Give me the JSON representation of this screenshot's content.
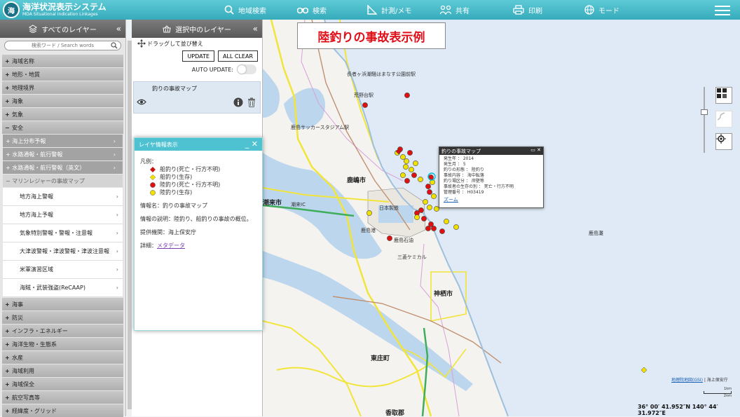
{
  "app": {
    "title": "海洋状況表示システム",
    "subtitle": "MDA Situational Indication Linkages",
    "badge": "海"
  },
  "nav": [
    {
      "label": "地域検索",
      "icon": "search-icon"
    },
    {
      "label": "検索",
      "icon": "binoculars-icon"
    },
    {
      "label": "計測/メモ",
      "icon": "ruler-icon"
    },
    {
      "label": "共有",
      "icon": "share-icon"
    },
    {
      "label": "印刷",
      "icon": "printer-icon"
    },
    {
      "label": "モード",
      "icon": "globe-icon"
    }
  ],
  "panel_all": {
    "title": "すべてのレイヤー",
    "search_placeholder": "検索ワード / Search words",
    "categories_top": [
      "海域名称",
      "地形・地質",
      "地理境界",
      "海象",
      "気象"
    ],
    "open_category": "安全",
    "subcategories": [
      "海上分布予報",
      "水路通報・航行警報",
      "水路通報・航行警報（英文）"
    ],
    "active_sub": "マリンレジャーの事故マップ",
    "leaves": [
      "地方海上警報",
      "地方海上予報",
      "気象特別警報・警報・注意報",
      "大津波警報・津波警報・津波注意報",
      "米軍演習区域",
      "海賊・武装強盗(ReCAAP)"
    ],
    "categories_bottom": [
      "海事",
      "防災",
      "インフラ・エネルギー",
      "海洋生物・生態系",
      "水産",
      "海域利用",
      "海域保全",
      "航空写真等",
      "経緯度・グリッド"
    ]
  },
  "panel_sel": {
    "title": "選択中のレイヤー",
    "drag_hint": "ドラッグして並び替え",
    "update": "UPDATE",
    "clear": "ALL CLEAR",
    "auto_update": "AUTO UPDATE:",
    "layer_name": "釣りの事故マップ"
  },
  "banner": "陸釣りの事故表示例",
  "info_dialog": {
    "title": "レイヤ情報表示",
    "legend_label": "凡例：",
    "legend": [
      {
        "label": "船釣り(死亡・行方不明)",
        "color": "#cc1111",
        "shape": "diamond"
      },
      {
        "label": "船釣り(生存)",
        "color": "#f0e000",
        "shape": "diamond"
      },
      {
        "label": "陸釣り(死亡・行方不明)",
        "color": "#dd1111",
        "shape": "circle"
      },
      {
        "label": "陸釣り(生存)",
        "color": "#f0e000",
        "shape": "circle"
      }
    ],
    "info_name": "情報名：釣りの事故マップ",
    "info_desc": "情報の説明：陸釣り、船釣りの事故の概位。",
    "provider": "提供機関：海上保安庁",
    "detail_label": "詳細：",
    "detail_link": "メタデータ"
  },
  "popup": {
    "title": "釣りの事故マップ",
    "rows": [
      "発生年 ： 2014",
      "発生月 ： 5",
      "釣りの形態 ： 陸釣り",
      "事故内容 ： 海中転落",
      "釣り場区分 ： 岸壁等",
      "事故者の生存の別 ： 死亡・行方不明",
      "管理番号 ： H03419"
    ],
    "zoom": "ズーム"
  },
  "map": {
    "places": [
      {
        "name": "鹿嶋市",
        "big": true
      },
      {
        "name": "神栖市",
        "big": true
      },
      {
        "name": "東庄町",
        "big": true
      },
      {
        "name": "香取郡",
        "big": true
      },
      {
        "name": "潮来市",
        "big": true
      },
      {
        "name": "長者ヶ浜潮騒はまなす公園前駅",
        "big": false
      },
      {
        "name": "荒野台駅",
        "big": false
      },
      {
        "name": "鹿島サッカースタジアム駅",
        "big": false
      },
      {
        "name": "鹿島港",
        "big": false
      },
      {
        "name": "鹿島石油",
        "big": false
      },
      {
        "name": "三菱ケミカル",
        "big": false
      },
      {
        "name": "潮来IC",
        "big": false
      },
      {
        "name": "鹿島灘",
        "big": false
      },
      {
        "name": "日本製鉄",
        "big": false
      }
    ],
    "attribution_link": "地理院地図(GSI)",
    "attribution_rest": " | 海上保安庁",
    "scale_top": "1km",
    "scale_bottom": "2nm",
    "coords": "36° 00′ 41.952″N 140° 44′ 31.972″E"
  }
}
